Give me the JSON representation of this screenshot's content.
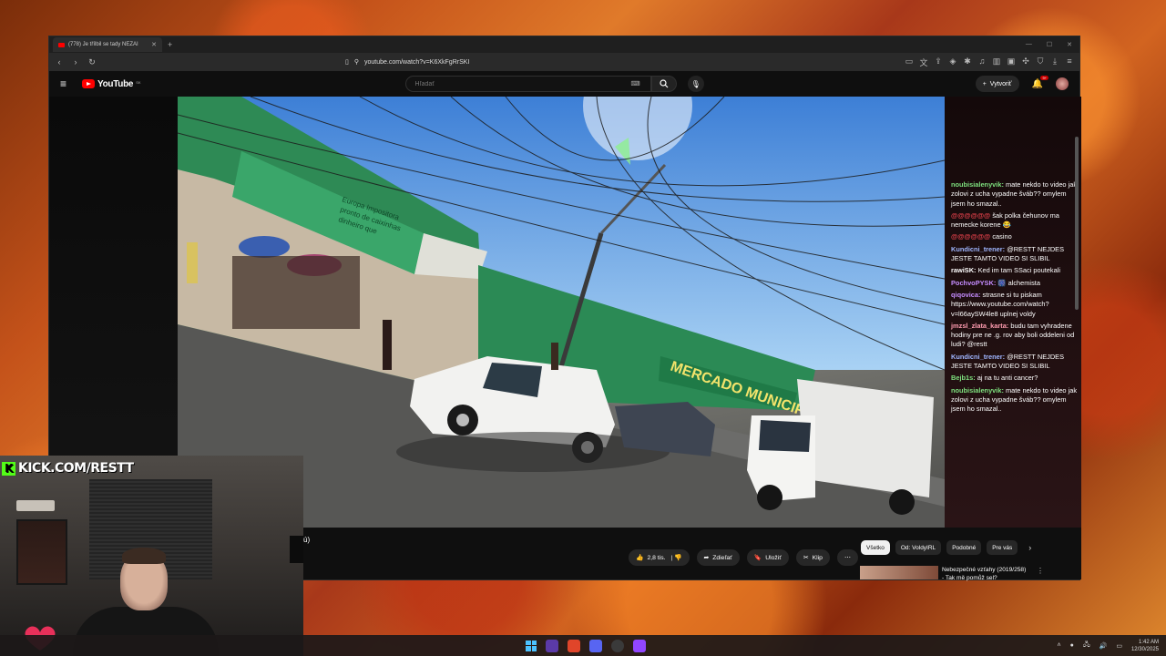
{
  "browser": {
    "tab_title": "(778) Je třílbil se tady NEZAI",
    "url": "youtube.com/watch?v=K6XkFgRrSKI"
  },
  "youtube": {
    "logo_text": "YouTube",
    "logo_region": "SK",
    "search_placeholder": "Hľadať",
    "create_label": "Vytvoriť",
    "notif_count": "9+"
  },
  "video_scene": {
    "shop_sign": "MERCADO MUNICIP",
    "store_sign_lines": [
      "Europa Impositora",
      "pronto de caixinhas",
      "dinheiro que"
    ]
  },
  "chat": [
    {
      "user": "noubisialenyvik:",
      "user_color": "#7ee07e",
      "text": "mate nekdo to video jak zolovi z ucha vypadne šváb?? omylem jsem ho smazal.."
    },
    {
      "user": "@@@@@@",
      "user_color": "#e0404a",
      "text": "šak polka čehunov ma nemecke korene 😂"
    },
    {
      "user": "@@@@@@",
      "user_color": "#e0404a",
      "text": "casino"
    },
    {
      "user": "Kundicni_trener:",
      "user_color": "#9fb6ff",
      "text": "@RESTT NEJDES JESTE TAMTO VIDEO SI SLIBIL"
    },
    {
      "user": "rawiSK:",
      "user_color": "#ffffff",
      "text": "Ked im tam SSaci poutekali"
    },
    {
      "user": "PochvoPYSK:",
      "user_color": "#c58cff",
      "text": "🎆 alchemista"
    },
    {
      "user": "qiqovica:",
      "user_color": "#c58cff",
      "text": "strasne si tu piskam https://www.youtube.com/watch?v=l66aySW4le8 uplnej voldy"
    },
    {
      "user": "jmzsl_zlata_karta:",
      "user_color": "#ff9db0",
      "text": "budu tam vyhradene hodiny pre ne .g. rov aby boli oddeleni od ludi? @restt"
    },
    {
      "user": "Kundicni_trener:",
      "user_color": "#9fb6ff",
      "text": "@RESTT NEJDES JESTE TAMTO VIDEO SI SLIBIL"
    },
    {
      "user": "Bejb1s:",
      "user_color": "#7ee07e",
      "text": "aj na tu anti cancer?"
    },
    {
      "user": "noubisialenyvik:",
      "user_color": "#7ee07e",
      "text": "mate nekdo to video jak zolovi z ucha vypadne šváb?? omylem jsem ho smazal.."
    }
  ],
  "actions": {
    "like_count": "2,8 tis.",
    "share_label": "Zdieľať",
    "save_label": "Uložiť",
    "clip_label": "Klip"
  },
  "chips": [
    "Všetko",
    "Od: VoldyIRL",
    "Podobné",
    "Pre vás"
  ],
  "recommendation": {
    "title": "Nebezpečné vzťahy (2019/258)",
    "subtitle": "- Tak mě pomůž sel?"
  },
  "webcam": {
    "kick_label": "KICK.COM/RESTT"
  },
  "under_fragment": "ú)",
  "taskbar": {
    "time": "1:42 AM",
    "date": "12/30/2025"
  }
}
